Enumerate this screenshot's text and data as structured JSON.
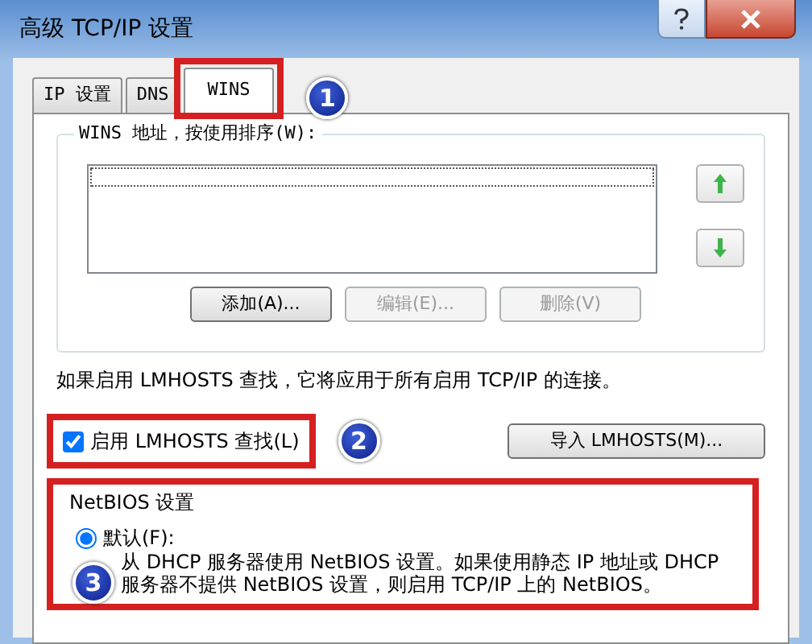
{
  "window": {
    "title": "高级 TCP/IP 设置"
  },
  "tabs": [
    {
      "label": "IP 设置",
      "selected": false
    },
    {
      "label": "DNS",
      "selected": false
    },
    {
      "label": "WINS",
      "selected": true
    }
  ],
  "wins_group": {
    "label": "WINS 地址，按使用排序(W):"
  },
  "list_buttons": [
    {
      "label": "添加(A)...",
      "disabled": false
    },
    {
      "label": "编辑(E)...",
      "disabled": true
    },
    {
      "label": "删除(V)",
      "disabled": true
    }
  ],
  "info_text": "如果启用 LMHOSTS 查找，它将应用于所有启用 TCP/IP 的连接。",
  "lmhosts_checkbox": {
    "label": "启用 LMHOSTS 查找(L)",
    "checked": true
  },
  "import_button": {
    "label": "导入 LMHOSTS(M)..."
  },
  "netbios": {
    "label": "NetBIOS 设置",
    "options": [
      {
        "label": "默认(F):",
        "selected": true,
        "description": "从 DHCP 服务器使用 NetBIOS 设置。如果使用静态 IP 地址或 DHCP 服务器不提供 NetBIOS 设置，则启用 TCP/IP 上的 NetBIOS。"
      }
    ]
  },
  "annotations": [
    {
      "label": "1"
    },
    {
      "label": "2"
    },
    {
      "label": "3"
    }
  ]
}
